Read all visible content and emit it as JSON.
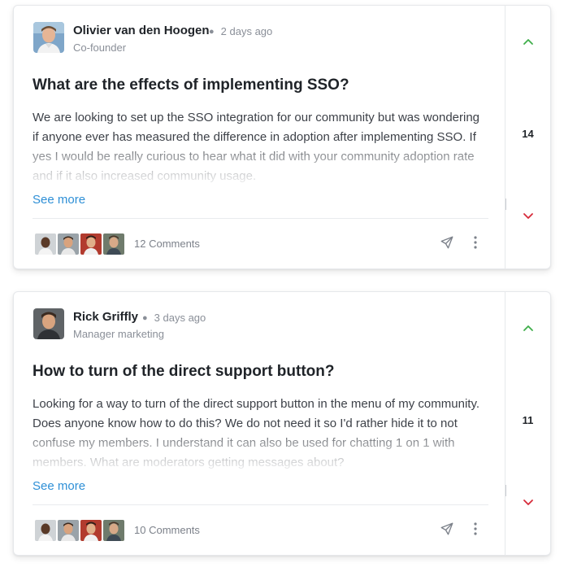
{
  "colors": {
    "accent_link": "#2e8fd6",
    "upvote": "#3fae4a",
    "downvote": "#d62b3a",
    "muted_text": "#8a8f98"
  },
  "posts": [
    {
      "author": "Olivier van den Hoogen",
      "time": "2 days ago",
      "role": "Co-founder",
      "title": "What are the effects of implementing SSO?",
      "body": "We are looking to set up the SSO integration for our community but was wondering if anyone ever has measured the difference in adoption after implementing SSO. If yes I would be really curious to hear what it did with your community adoption rate and if it also increased community usage.",
      "see_more": "See more",
      "comments": "12 Comments",
      "votes": "14",
      "icons": {
        "up": "chevron-up-icon",
        "down": "chevron-down-icon",
        "share": "send-icon",
        "more": "more-vertical-icon"
      }
    },
    {
      "author": "Rick Griffly",
      "time": "3 days ago",
      "role": "Manager marketing",
      "title": "How to turn of the direct support button?",
      "body": "Looking for a way to turn of the direct support button in the menu of my community. Does anyone know how to do this? We do not need it so I'd rather hide it to not confuse my members. I understand it can also be used for chatting 1 on 1 with members. What are moderators getting messages about?",
      "see_more": "See more",
      "comments": "10 Comments",
      "votes": "11",
      "icons": {
        "up": "chevron-up-icon",
        "down": "chevron-down-icon",
        "share": "send-icon",
        "more": "more-vertical-icon"
      }
    }
  ]
}
